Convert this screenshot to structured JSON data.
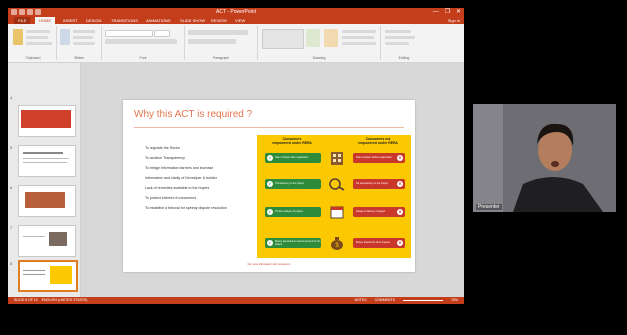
{
  "window": {
    "title": "ACT - PowerPoint",
    "controls": [
      "—",
      "❐",
      "✕"
    ]
  },
  "ribbon": {
    "tabs": [
      "FILE",
      "HOME",
      "INSERT",
      "DESIGN",
      "TRANSITIONS",
      "ANIMATIONS",
      "SLIDE SHOW",
      "REVIEW",
      "VIEW"
    ],
    "active_tab": "HOME",
    "sign_in": "Sign in",
    "groups": [
      "Clipboard",
      "Slides",
      "Font",
      "Paragraph",
      "Drawing",
      "Editing"
    ]
  },
  "thumbnails": {
    "numbers": [
      "4",
      "5",
      "6",
      "7",
      "8"
    ],
    "selected_index": 4
  },
  "slide": {
    "title": "Why this ACT is required ?",
    "bullets": [
      "To regulate the Sector",
      "To achieve Transparency",
      "To bridge information barriers and increase",
      "Information and clarity of Developer & builder",
      "Lack of remedies available to the buyers",
      "To protect interest of consumers",
      "To establish a tribunal for speedy dispute resolution"
    ],
    "infographic": {
      "left_header": "Consumers\nempowered under RERA",
      "right_header": "Consumers not\nempowered under RERA",
      "rows": [
        {
          "left": "Sale of project after registration",
          "right": "Sale of project without registration"
        },
        {
          "left": "Transparency in the project",
          "right": "No transparency in the project"
        },
        {
          "left": "On time delivery of project",
          "right": "Delays in delivery of project"
        },
        {
          "left": "Money deposited in escrow account for the project",
          "right": "Money diverted to other projects"
        }
      ]
    },
    "footnote": "For more information visit: rera.gov.in"
  },
  "status": {
    "slide_info": "SLIDE 8 OF 12",
    "language": "ENGLISH (UNITED STATES)",
    "notes": "NOTES",
    "comments": "COMMENTS",
    "zoom": "76%"
  },
  "webcam": {
    "name": "Presenter"
  }
}
